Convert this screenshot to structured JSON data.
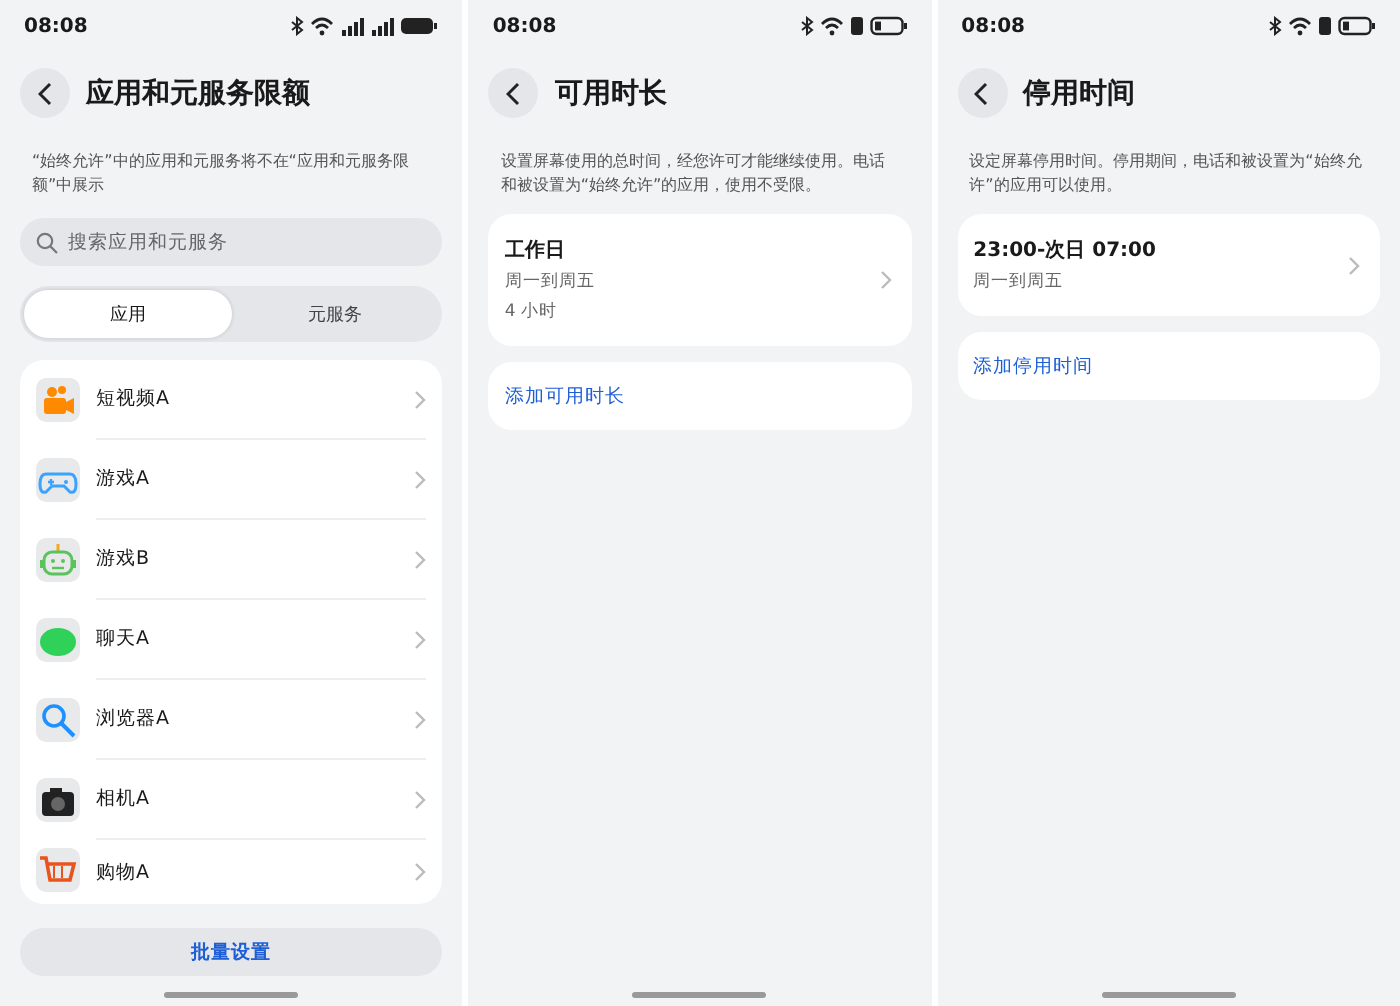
{
  "screens": [
    {
      "kind": "apps",
      "status": {
        "time": "08:08"
      },
      "title": "应用和元服务限额",
      "description": "“始终允许”中的应用和元服务将不在“应用和元服务限额”中展示",
      "search": {
        "placeholder": "搜索应用和元服务"
      },
      "tabs": [
        {
          "label": "应用",
          "selected": true
        },
        {
          "label": "元服务",
          "selected": false
        }
      ],
      "apps": [
        {
          "name": "短视频A"
        },
        {
          "name": "游戏A"
        },
        {
          "name": "游戏B"
        },
        {
          "name": "聊天A"
        },
        {
          "name": "浏览器A"
        },
        {
          "name": "相机A"
        },
        {
          "name": "购物A"
        }
      ],
      "button": "批量设置"
    },
    {
      "kind": "schedule",
      "status": {
        "time": "08:08"
      },
      "title": "可用时长",
      "description": "设置屏幕使用的总时间，经您许可才能继续使用。电话和被设置为“始终允许”的应用，使用不受限。",
      "items": [
        {
          "title": "工作日",
          "lines": [
            "周一到周五",
            "4 小时"
          ]
        }
      ],
      "add_link": "添加可用时长"
    },
    {
      "kind": "schedule",
      "status": {
        "time": "08:08"
      },
      "title": "停用时间",
      "description": "设定屏幕停用时间。停用期间，电话和被设置为“始终允许”的应用可以使用。",
      "items": [
        {
          "title": "23:00-次日 07:00",
          "lines": [
            "周一到周五"
          ]
        }
      ],
      "add_link": "添加停用时间"
    }
  ]
}
